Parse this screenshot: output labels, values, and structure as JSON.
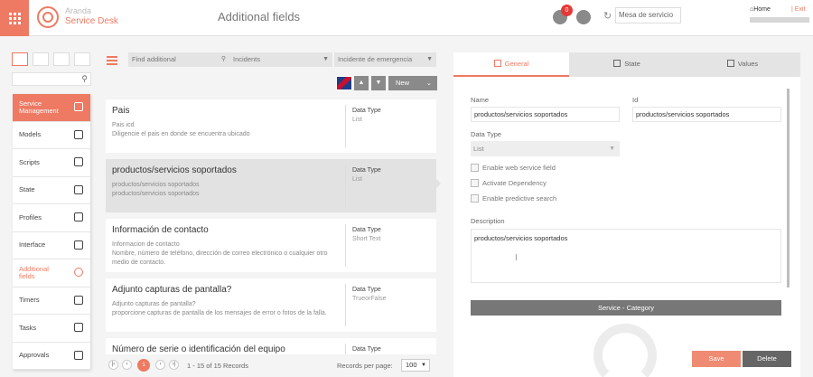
{
  "header": {
    "brand_line1": "Aranda",
    "brand_line2": "Service Desk",
    "title": "Additional fields",
    "notification_count": "0",
    "project_value": "Mesa de servicio",
    "home_label": "Home",
    "exit_label": "| Exit"
  },
  "sidebar": {
    "items": [
      {
        "label": "Service Management",
        "icon": "copy-icon"
      },
      {
        "label": "Models",
        "icon": "grid-icon"
      },
      {
        "label": "Scripts",
        "icon": "document-icon"
      },
      {
        "label": "State",
        "icon": "copy-icon"
      },
      {
        "label": "Profiles",
        "icon": "profile-icon"
      },
      {
        "label": "Interface",
        "icon": "monitor-icon"
      },
      {
        "label": "Additional fields",
        "icon": "plus-circle-icon"
      },
      {
        "label": "Timers",
        "icon": "stopwatch-icon"
      },
      {
        "label": "Tasks",
        "icon": "tasks-icon"
      },
      {
        "label": "Approvals",
        "icon": "approval-icon"
      }
    ]
  },
  "toolbar": {
    "search_placeholder": "Find additional",
    "category_value": "Incidents",
    "type_value": "Incidente de emergencia",
    "new_label": "New"
  },
  "fields": [
    {
      "name": "Pais",
      "desc1": "Pais icd",
      "desc2": "Diligencie el pais en donde se encuentra ubicado",
      "type_label": "Data Type",
      "type_value": "List"
    },
    {
      "name": "productos/servicios soportados",
      "desc1": "productos/servicios soportados",
      "desc2": "productos/servicios soportados",
      "type_label": "Data Type",
      "type_value": "List"
    },
    {
      "name": "Información de contacto",
      "desc1": "Informacion de contacto",
      "desc2": "Nombre, número de teléfono, dirección de correo electrónico o cualquier otro medio de contacto.",
      "type_label": "Data Type",
      "type_value": "Short Text"
    },
    {
      "name": "Adjunto capturas de pantalla?",
      "desc1": "Adjunto capturas de pantalla?",
      "desc2": "proporcione capturas de pantalla de los mensajes de error o fotos de la falla.",
      "type_label": "Data Type",
      "type_value": "TrueorFalse"
    },
    {
      "name": "Número de serie o identificación del equipo",
      "desc1": "",
      "desc2": "",
      "type_label": "Data Type",
      "type_value": ""
    }
  ],
  "pagination": {
    "current_page": "1",
    "info": "1 - 15 of 15 Records",
    "rpp_label": "Records per page:",
    "rpp_value": "100"
  },
  "detail": {
    "tabs": [
      {
        "label": "General",
        "icon": "edit-icon"
      },
      {
        "label": "State",
        "icon": "copy-icon"
      },
      {
        "label": "Values",
        "icon": "values-icon"
      }
    ],
    "name_label": "Name",
    "name_value": "productos/servicios soportados",
    "id_label": "Id",
    "id_value": "productos/servicios soportados",
    "datatype_label": "Data Type",
    "datatype_value": "List",
    "checkboxes": [
      "Enable web service field",
      "Activate Dependency",
      "Enable predictive search"
    ],
    "description_label": "Description",
    "description_value": "productos/servicios soportados",
    "section_title": "Service - Category",
    "save_label": "Save",
    "delete_label": "Delete"
  },
  "colors": {
    "accent": "#ee7a63",
    "dark_button": "#666666"
  }
}
